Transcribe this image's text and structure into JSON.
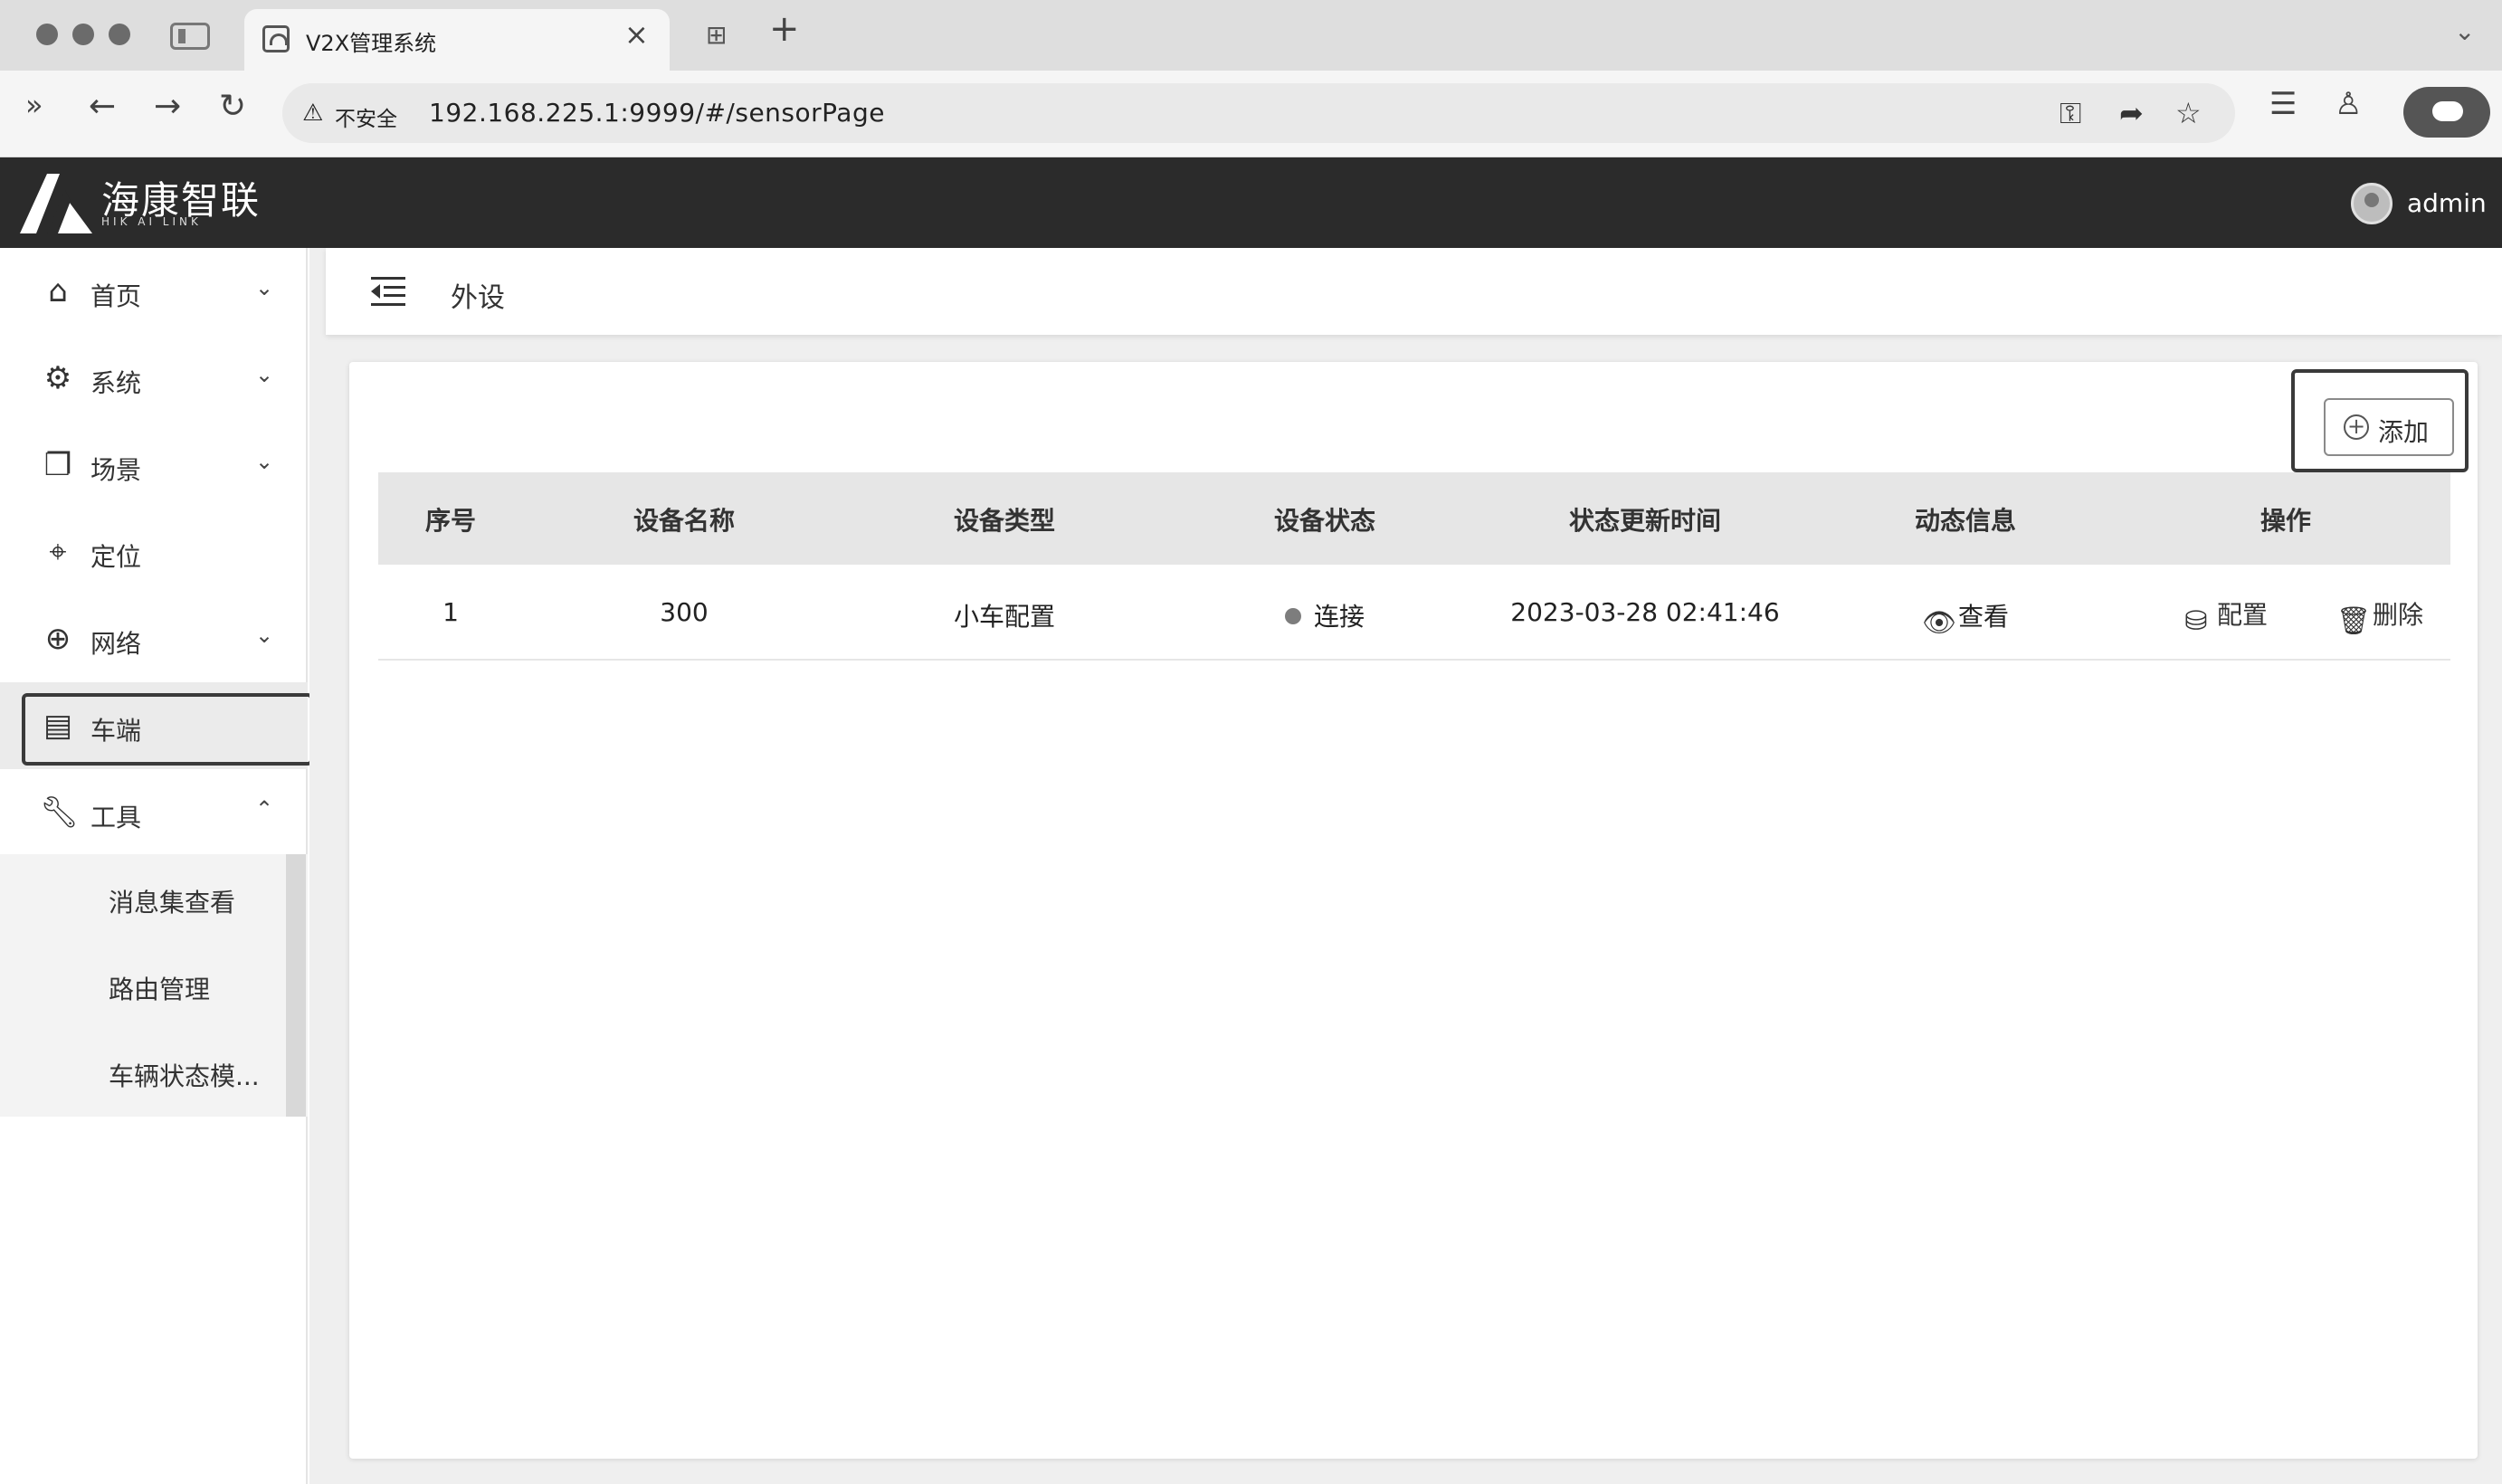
{
  "browser": {
    "tab_title": "V2X管理系统",
    "security_label": "不安全",
    "url": "192.168.225.1:9999/#/sensorPage"
  },
  "header": {
    "logo_text": "海康智联",
    "logo_sub": "HIK AI LINK",
    "user": "admin"
  },
  "sidebar": {
    "items": [
      {
        "label": "首页",
        "icon": "home-icon",
        "arrow": "down"
      },
      {
        "label": "系统",
        "icon": "settings-icon",
        "arrow": "down"
      },
      {
        "label": "场景",
        "icon": "layers-icon",
        "arrow": "down"
      },
      {
        "label": "定位",
        "icon": "location-icon",
        "arrow": ""
      },
      {
        "label": "网络",
        "icon": "globe-icon",
        "arrow": "down"
      },
      {
        "label": "车端",
        "icon": "vehicle-terminal-icon",
        "arrow": "",
        "active": true
      },
      {
        "label": "工具",
        "icon": "wrench-icon",
        "arrow": "up"
      }
    ],
    "submenu": [
      "消息集查看",
      "路由管理",
      "车辆状态模..."
    ]
  },
  "breadcrumb": {
    "current": "外设"
  },
  "toolbar": {
    "add_label": "添加"
  },
  "table": {
    "columns": [
      "序号",
      "设备名称",
      "设备类型",
      "设备状态",
      "状态更新时间",
      "动态信息",
      "操作"
    ],
    "rows": [
      {
        "index": "1",
        "name": "300",
        "type": "小车配置",
        "status": "连接",
        "updated": "2023-03-28 02:41:46",
        "dynamic": "查看",
        "actions": [
          "配置",
          "删除"
        ]
      }
    ]
  },
  "colors": {
    "header_bg": "#2b2b2b",
    "status_dot": "#7d7d7d",
    "table_header_bg": "#e6e6e6"
  }
}
